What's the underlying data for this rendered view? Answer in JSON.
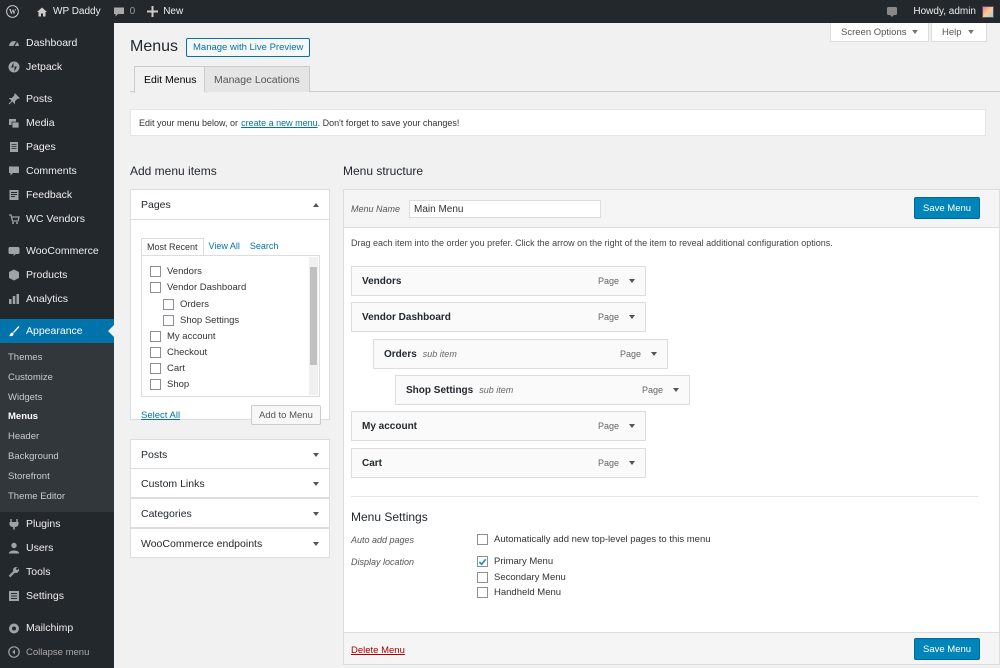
{
  "adminbar": {
    "site_name": "WP Daddy",
    "comments_count": "0",
    "new_label": "New",
    "howdy": "Howdy, admin"
  },
  "sidebar": {
    "items": [
      {
        "label": "Dashboard",
        "icon": "dashboard-icon"
      },
      {
        "label": "Jetpack",
        "icon": "jetpack-icon"
      },
      {
        "label": "Posts",
        "icon": "pin-icon"
      },
      {
        "label": "Media",
        "icon": "media-icon"
      },
      {
        "label": "Pages",
        "icon": "page-icon"
      },
      {
        "label": "Comments",
        "icon": "comment-icon"
      },
      {
        "label": "Feedback",
        "icon": "feedback-icon"
      },
      {
        "label": "WC Vendors",
        "icon": "cart-icon"
      },
      {
        "label": "WooCommerce",
        "icon": "woo-icon"
      },
      {
        "label": "Products",
        "icon": "box-icon"
      },
      {
        "label": "Analytics",
        "icon": "chart-icon"
      },
      {
        "label": "Appearance",
        "icon": "brush-icon"
      },
      {
        "label": "Plugins",
        "icon": "plug-icon"
      },
      {
        "label": "Users",
        "icon": "user-icon"
      },
      {
        "label": "Tools",
        "icon": "wrench-icon"
      },
      {
        "label": "Settings",
        "icon": "settings-icon"
      },
      {
        "label": "Mailchimp",
        "icon": "mailchimp-icon"
      }
    ],
    "appearance_sub": [
      "Themes",
      "Customize",
      "Widgets",
      "Menus",
      "Header",
      "Background",
      "Storefront",
      "Theme Editor"
    ],
    "collapse": "Collapse menu"
  },
  "top": {
    "screen_options": "Screen Options",
    "help": "Help"
  },
  "page": {
    "title": "Menus",
    "live_preview": "Manage with Live Preview",
    "tab_edit": "Edit Menus",
    "tab_locations": "Manage Locations",
    "notice_before": "Edit your menu below, or",
    "notice_link": "create a new menu",
    "notice_after": ". Don't forget to save your changes!"
  },
  "add_items": {
    "heading": "Add menu items",
    "pages_title": "Pages",
    "tabs": [
      "Most Recent",
      "View All",
      "Search"
    ],
    "pages": [
      "Vendors",
      "Vendor Dashboard",
      "Orders",
      "Shop Settings",
      "My account",
      "Checkout",
      "Cart",
      "Shop"
    ],
    "select_all": "Select All",
    "add_to_menu": "Add to Menu",
    "sections": [
      "Posts",
      "Custom Links",
      "Categories",
      "WooCommerce endpoints"
    ]
  },
  "structure": {
    "heading": "Menu structure",
    "menu_name_label": "Menu Name",
    "menu_name_value": "Main Menu",
    "save": "Save Menu",
    "instructions": "Drag each item into the order you prefer. Click the arrow on the right of the item to reveal additional configuration options.",
    "items": [
      {
        "title": "Vendors",
        "sub": "",
        "type": "Page"
      },
      {
        "title": "Vendor Dashboard",
        "sub": "",
        "type": "Page"
      },
      {
        "title": "Orders",
        "sub": "sub item",
        "type": "Page"
      },
      {
        "title": "Shop Settings",
        "sub": "sub item",
        "type": "Page"
      },
      {
        "title": "My account",
        "sub": "",
        "type": "Page"
      },
      {
        "title": "Cart",
        "sub": "",
        "type": "Page"
      }
    ],
    "settings_heading": "Menu Settings",
    "auto_add_label": "Auto add pages",
    "auto_add_option": "Automatically add new top-level pages to this menu",
    "display_location_label": "Display location",
    "locations": [
      {
        "label": "Primary Menu",
        "checked": true
      },
      {
        "label": "Secondary Menu",
        "checked": false
      },
      {
        "label": "Handheld Menu",
        "checked": false
      }
    ],
    "delete": "Delete Menu"
  },
  "colors": {
    "accent": "#0073aa",
    "button": "#0085ba",
    "sidebar": "#23282d",
    "delete": "#a00"
  }
}
